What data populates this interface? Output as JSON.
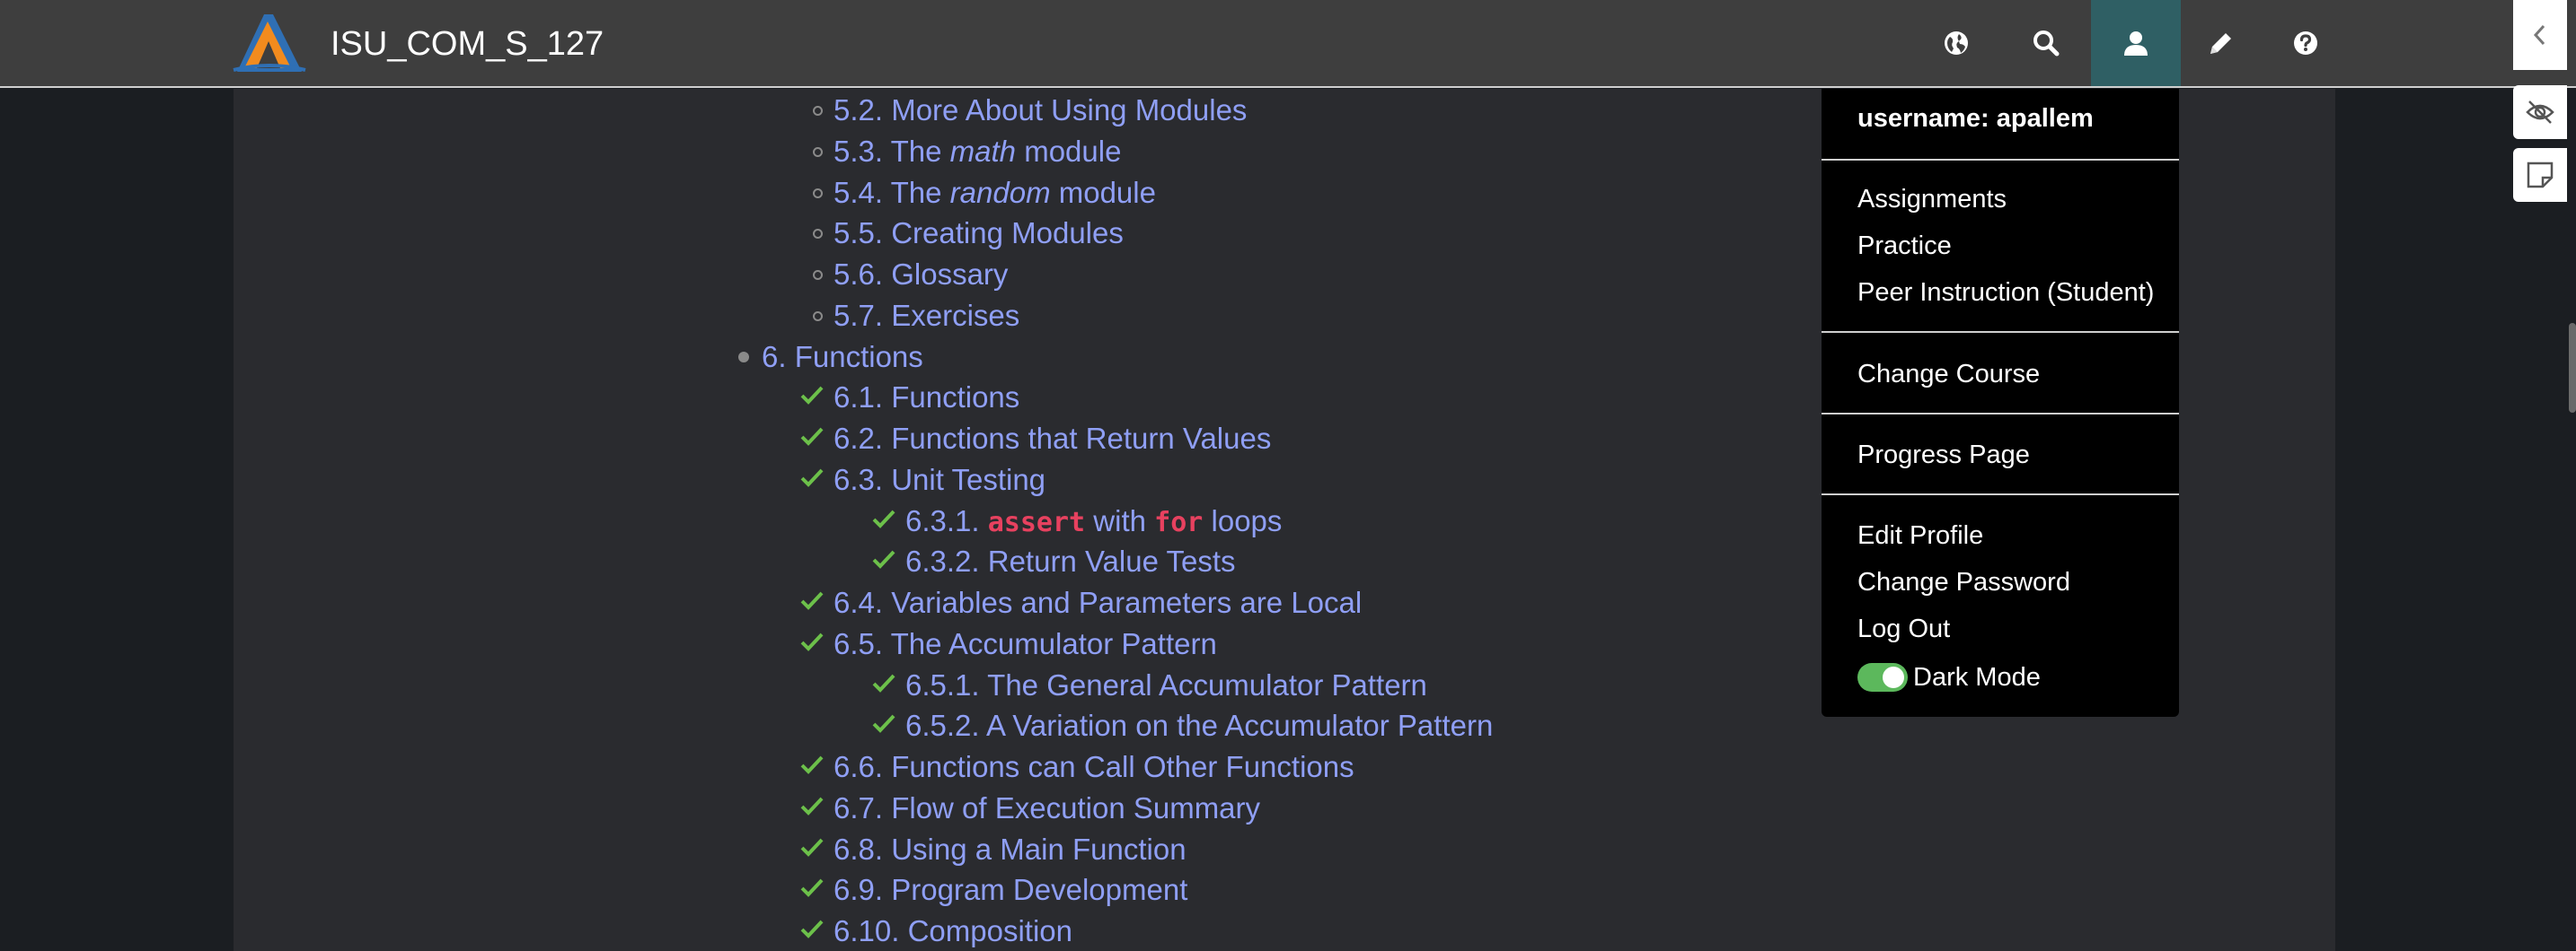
{
  "navbar": {
    "course_title": "ISU_COM_S_127",
    "icons": [
      "globe-icon",
      "search-icon",
      "user-icon",
      "pencil-icon",
      "help-icon"
    ]
  },
  "toc": {
    "items": [
      {
        "num": "5.2.",
        "text": "More About Using Modules",
        "level": 2,
        "marker": "circle"
      },
      {
        "num": "5.3.",
        "pre": "The",
        "em": "math",
        "post": "module",
        "level": 2,
        "marker": "circle"
      },
      {
        "num": "5.4.",
        "pre": "The",
        "em": "random",
        "post": "module",
        "level": 2,
        "marker": "circle"
      },
      {
        "num": "5.5.",
        "text": "Creating Modules",
        "level": 2,
        "marker": "circle"
      },
      {
        "num": "5.6.",
        "text": "Glossary",
        "level": 2,
        "marker": "circle"
      },
      {
        "num": "5.7.",
        "text": "Exercises",
        "level": 2,
        "marker": "circle"
      },
      {
        "num": "6.",
        "text": "Functions",
        "level": 1,
        "marker": "dot"
      },
      {
        "num": "6.1.",
        "text": "Functions",
        "level": 2,
        "marker": "check"
      },
      {
        "num": "6.2.",
        "text": "Functions that Return Values",
        "level": 2,
        "marker": "check"
      },
      {
        "num": "6.3.",
        "text": "Unit Testing",
        "level": 2,
        "marker": "check"
      },
      {
        "num": "6.3.1.",
        "code1": "assert",
        "mid": "with",
        "code2": "for",
        "post": "loops",
        "level": 3,
        "marker": "check"
      },
      {
        "num": "6.3.2.",
        "text": "Return Value Tests",
        "level": 3,
        "marker": "check"
      },
      {
        "num": "6.4.",
        "text": "Variables and Parameters are Local",
        "level": 2,
        "marker": "check"
      },
      {
        "num": "6.5.",
        "text": "The Accumulator Pattern",
        "level": 2,
        "marker": "check"
      },
      {
        "num": "6.5.1.",
        "text": "The General Accumulator Pattern",
        "level": 3,
        "marker": "check"
      },
      {
        "num": "6.5.2.",
        "text": "A Variation on the Accumulator Pattern",
        "level": 3,
        "marker": "check"
      },
      {
        "num": "6.6.",
        "text": "Functions can Call Other Functions",
        "level": 2,
        "marker": "check"
      },
      {
        "num": "6.7.",
        "text": "Flow of Execution Summary",
        "level": 2,
        "marker": "check"
      },
      {
        "num": "6.8.",
        "text": "Using a Main Function",
        "level": 2,
        "marker": "check"
      },
      {
        "num": "6.9.",
        "text": "Program Development",
        "level": 2,
        "marker": "check"
      },
      {
        "num": "6.10.",
        "text": "Composition",
        "level": 2,
        "marker": "check"
      }
    ]
  },
  "user_menu": {
    "username": "username: apallem",
    "assignments": "Assignments",
    "practice": "Practice",
    "peer_instruction": "Peer Instruction (Student)",
    "change_course": "Change Course",
    "progress_page": "Progress Page",
    "edit_profile": "Edit Profile",
    "change_password": "Change Password",
    "log_out": "Log Out",
    "dark_mode": "Dark Mode",
    "dark_mode_on": true
  },
  "colors": {
    "link": "#8f9ff5",
    "check": "#6cc04a",
    "code": "#e7415f",
    "toggle_on": "#5cb85c",
    "active_nav": "#2f5f64"
  }
}
